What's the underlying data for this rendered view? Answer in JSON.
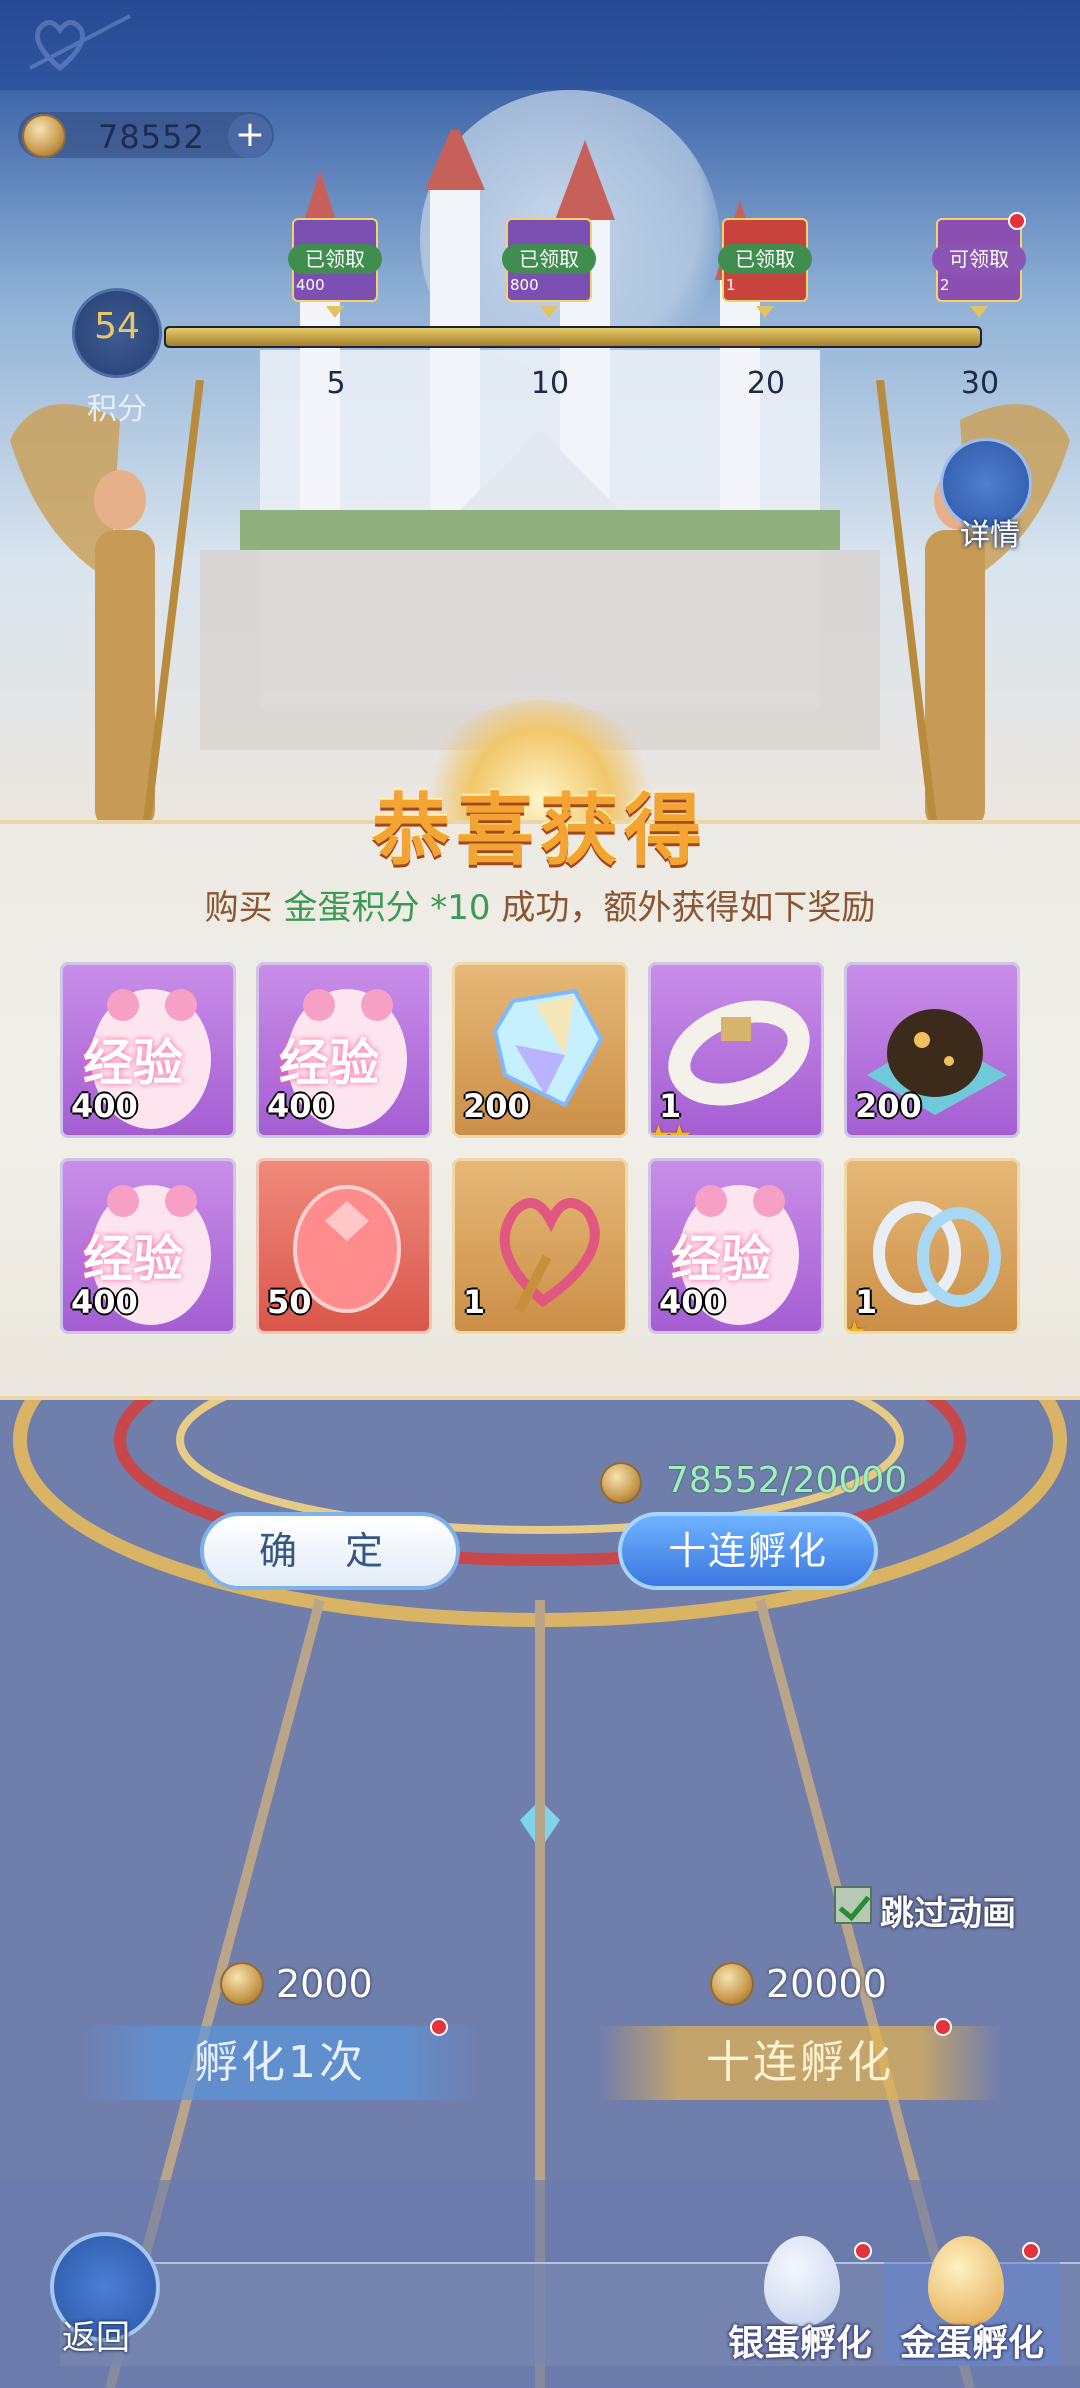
{
  "currency": {
    "amount": "78552",
    "plus_label": "+"
  },
  "score": {
    "value": "54",
    "label": "积分"
  },
  "milestones": [
    {
      "status": "已领取",
      "qty": "400",
      "label": "5",
      "color": "#7c4fb3"
    },
    {
      "status": "已领取",
      "qty": "800",
      "label": "10",
      "color": "#7c4fb3"
    },
    {
      "status": "已领取",
      "qty": "1",
      "label": "20",
      "color": "#c9433d"
    },
    {
      "status": "可领取",
      "qty": "2",
      "label": "30",
      "color": "#8a4fb0"
    }
  ],
  "details": {
    "label": "详情"
  },
  "popup": {
    "title": "恭喜获得",
    "desc_prefix": "购买 ",
    "desc_item": "金蛋积分",
    "desc_count": " *10",
    "desc_suffix": " 成功，额外获得如下奖励"
  },
  "rewards": [
    {
      "icon": "exp-egg-icon",
      "qty": "400",
      "frame": "purple",
      "stars": "",
      "text": "经验"
    },
    {
      "icon": "exp-egg-icon",
      "qty": "400",
      "frame": "purple",
      "stars": "",
      "text": "经验"
    },
    {
      "icon": "crystal-icon",
      "qty": "200",
      "frame": "orange",
      "stars": "",
      "text": ""
    },
    {
      "icon": "collar-icon",
      "qty": "1",
      "frame": "purple",
      "stars": "★★",
      "text": ""
    },
    {
      "icon": "galaxy-egg-icon",
      "qty": "200",
      "frame": "purple",
      "stars": "",
      "text": ""
    },
    {
      "icon": "exp-egg-icon",
      "qty": "400",
      "frame": "purple",
      "stars": "",
      "text": "经验"
    },
    {
      "icon": "red-egg-icon",
      "qty": "50",
      "frame": "red",
      "stars": "",
      "text": ""
    },
    {
      "icon": "heart-wand-icon",
      "qty": "1",
      "frame": "orange",
      "stars": "",
      "text": ""
    },
    {
      "icon": "exp-egg-icon",
      "qty": "400",
      "frame": "purple",
      "stars": "",
      "text": "经验"
    },
    {
      "icon": "bracelet-icon",
      "qty": "1",
      "frame": "orange",
      "stars": "★",
      "text": ""
    }
  ],
  "buttons": {
    "confirm": "确 定",
    "ten_hatch": "十连孵化"
  },
  "cost": {
    "display": "78552/20000"
  },
  "skip_animation": {
    "label": "跳过动画",
    "checked": true
  },
  "hatch": {
    "single": {
      "price": "2000",
      "label": "孵化1次"
    },
    "ten": {
      "price": "20000",
      "label": "十连孵化"
    }
  },
  "bottom_nav": {
    "back": "返回",
    "silver_tab": "银蛋孵化",
    "gold_tab": "金蛋孵化"
  }
}
